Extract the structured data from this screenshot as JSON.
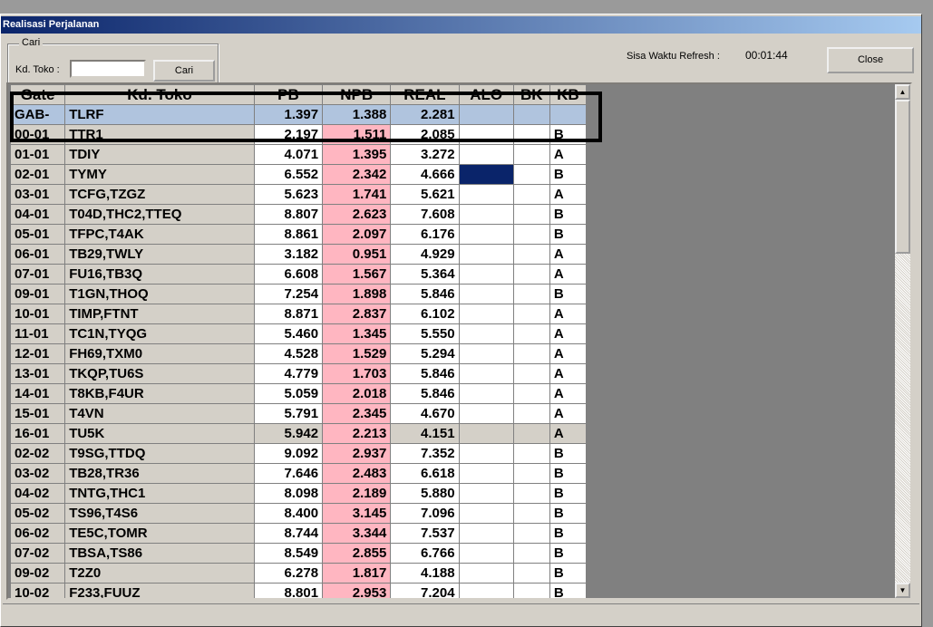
{
  "window": {
    "title": "Realisasi Perjalanan"
  },
  "search": {
    "group_label": "Cari",
    "kd_toko_label": "Kd. Toko :",
    "kd_toko_value": "",
    "button_label": "Cari"
  },
  "refresh": {
    "label": "Sisa Waktu Refresh  :",
    "value": "00:01:44"
  },
  "close_button": {
    "label": "Close"
  },
  "table": {
    "headers": [
      "Gate",
      "Kd. Toko",
      "PB",
      "NPB",
      "REAL",
      "ALO",
      "BK",
      "KB"
    ],
    "rows": [
      {
        "gate": "GAB-",
        "kd": "TLRF",
        "pb": "1.397",
        "npb": "1.388",
        "real": "2.281",
        "kb": ""
      },
      {
        "gate": "00-01",
        "kd": "TTR1",
        "pb": "2.197",
        "npb": "1.511",
        "real": "2.085",
        "kb": "B"
      },
      {
        "gate": "01-01",
        "kd": "TDIY",
        "pb": "4.071",
        "npb": "1.395",
        "real": "3.272",
        "kb": "A"
      },
      {
        "gate": "02-01",
        "kd": "TYMY",
        "pb": "6.552",
        "npb": "2.342",
        "real": "4.666",
        "kb": "B"
      },
      {
        "gate": "03-01",
        "kd": "TCFG,TZGZ",
        "pb": "5.623",
        "npb": "1.741",
        "real": "5.621",
        "kb": "A"
      },
      {
        "gate": "04-01",
        "kd": "T04D,THC2,TTEQ",
        "pb": "8.807",
        "npb": "2.623",
        "real": "7.608",
        "kb": "B"
      },
      {
        "gate": "05-01",
        "kd": "TFPC,T4AK",
        "pb": "8.861",
        "npb": "2.097",
        "real": "6.176",
        "kb": "B"
      },
      {
        "gate": "06-01",
        "kd": "TB29,TWLY",
        "pb": "3.182",
        "npb": "0.951",
        "real": "4.929",
        "kb": "A"
      },
      {
        "gate": "07-01",
        "kd": "FU16,TB3Q",
        "pb": "6.608",
        "npb": "1.567",
        "real": "5.364",
        "kb": "A"
      },
      {
        "gate": "09-01",
        "kd": "T1GN,THOQ",
        "pb": "7.254",
        "npb": "1.898",
        "real": "5.846",
        "kb": "B"
      },
      {
        "gate": "10-01",
        "kd": "TIMP,FTNT",
        "pb": "8.871",
        "npb": "2.837",
        "real": "6.102",
        "kb": "A"
      },
      {
        "gate": "11-01",
        "kd": "TC1N,TYQG",
        "pb": "5.460",
        "npb": "1.345",
        "real": "5.550",
        "kb": "A"
      },
      {
        "gate": "12-01",
        "kd": "FH69,TXM0",
        "pb": "4.528",
        "npb": "1.529",
        "real": "5.294",
        "kb": "A"
      },
      {
        "gate": "13-01",
        "kd": "TKQP,TU6S",
        "pb": "4.779",
        "npb": "1.703",
        "real": "5.846",
        "kb": "A"
      },
      {
        "gate": "14-01",
        "kd": "T8KB,F4UR",
        "pb": "5.059",
        "npb": "2.018",
        "real": "5.846",
        "kb": "A"
      },
      {
        "gate": "15-01",
        "kd": "T4VN",
        "pb": "5.791",
        "npb": "2.345",
        "real": "4.670",
        "kb": "A"
      },
      {
        "gate": "16-01",
        "kd": "TU5K",
        "pb": "5.942",
        "npb": "2.213",
        "real": "4.151",
        "kb": "A"
      },
      {
        "gate": "02-02",
        "kd": "T9SG,TTDQ",
        "pb": "9.092",
        "npb": "2.937",
        "real": "7.352",
        "kb": "B"
      },
      {
        "gate": "03-02",
        "kd": "TB28,TR36",
        "pb": "7.646",
        "npb": "2.483",
        "real": "6.618",
        "kb": "B"
      },
      {
        "gate": "04-02",
        "kd": "TNTG,THC1",
        "pb": "8.098",
        "npb": "2.189",
        "real": "5.880",
        "kb": "B"
      },
      {
        "gate": "05-02",
        "kd": "TS96,T4S6",
        "pb": "8.400",
        "npb": "3.145",
        "real": "7.096",
        "kb": "B"
      },
      {
        "gate": "06-02",
        "kd": "TE5C,TOMR",
        "pb": "8.744",
        "npb": "3.344",
        "real": "7.537",
        "kb": "B"
      },
      {
        "gate": "07-02",
        "kd": "TBSA,TS86",
        "pb": "8.549",
        "npb": "2.855",
        "real": "6.766",
        "kb": "B"
      },
      {
        "gate": "09-02",
        "kd": "T2Z0",
        "pb": "6.278",
        "npb": "1.817",
        "real": "4.188",
        "kb": "B"
      },
      {
        "gate": "10-02",
        "kd": "F233,FUUZ",
        "pb": "8.801",
        "npb": "2.953",
        "real": "7.204",
        "kb": "B"
      }
    ]
  },
  "icons": {
    "scroll_up": "scroll-up-arrow-icon",
    "scroll_down": "scroll-down-arrow-icon"
  },
  "colors": {
    "title_start": "#0a246a",
    "npb_cell": "#ffb6c1",
    "selected_row": "#b0c4de",
    "alo_marker": "#0a246a"
  }
}
